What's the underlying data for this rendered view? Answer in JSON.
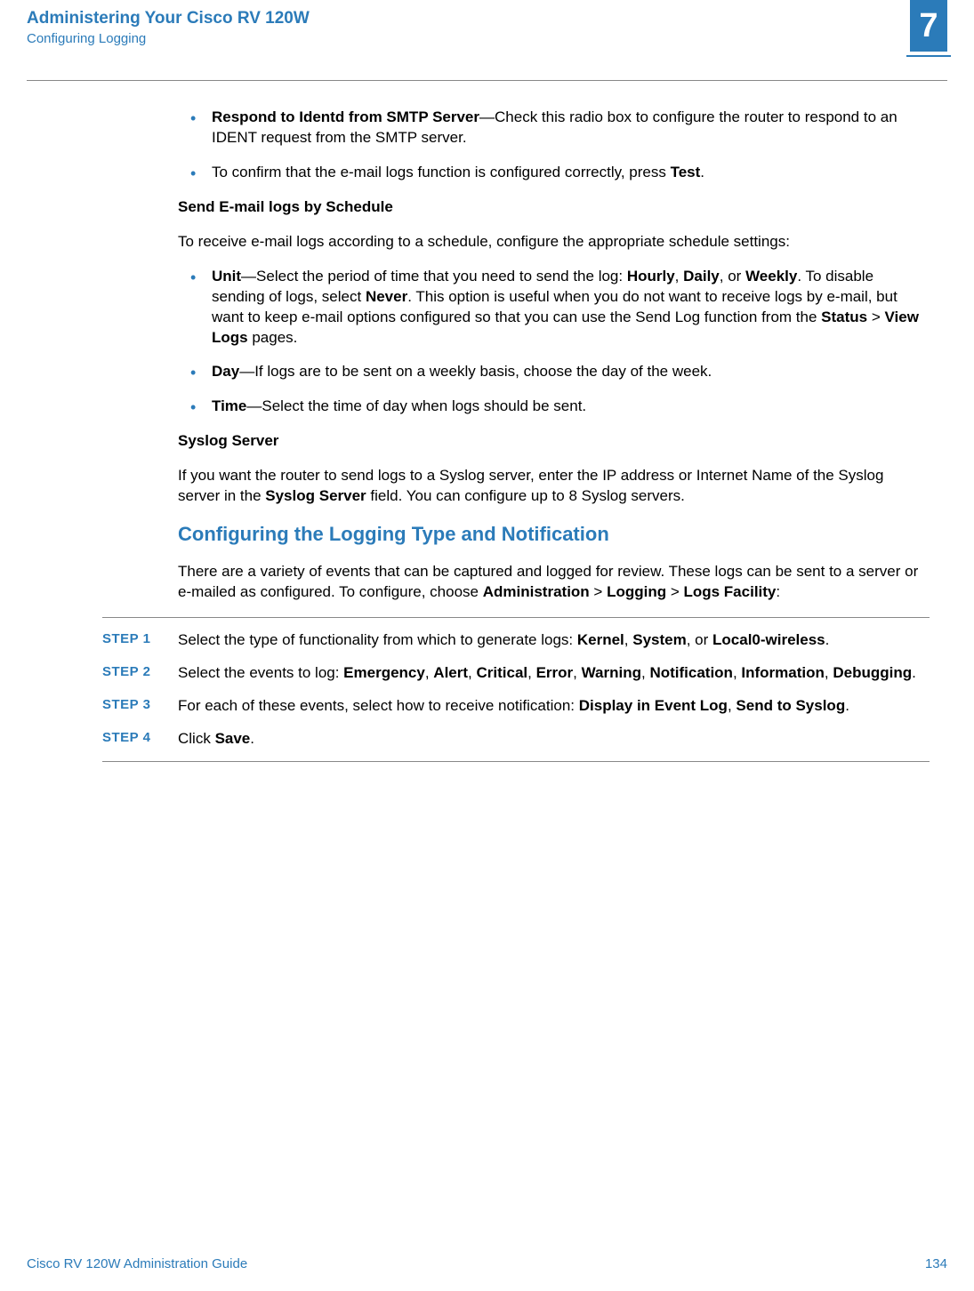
{
  "header": {
    "title": "Administering Your Cisco RV 120W",
    "subtitle": "Configuring Logging",
    "chapter_number": "7"
  },
  "top_bullets": [
    {
      "bold_lead": "Respond to Identd from SMTP Server",
      "rest": "—Check this radio box to configure the router to respond to an IDENT request from the SMTP server."
    },
    {
      "plain_pre": "To confirm that the e-mail logs function is configured correctly, press ",
      "bold_tail": "Test",
      "tail_punct": "."
    }
  ],
  "send_schedule": {
    "heading": "Send E-mail logs by Schedule",
    "intro": "To receive e-mail logs according to a schedule, configure the appropriate schedule settings:",
    "bullets": {
      "unit": {
        "lead": "Unit",
        "t1": "—Select the period of time that you need to send the log: ",
        "b1": "Hourly",
        "t2": ", ",
        "b2": "Daily",
        "t3": ", or ",
        "b3": "Weekly",
        "t4": ". To disable sending of logs, select ",
        "b4": "Never",
        "t5": ". This option is useful when you do not want to receive logs by e-mail, but want to keep e-mail options configured so that you can use the Send Log function from the ",
        "b5": "Status",
        "t6": " > ",
        "b6": "View Logs",
        "t7": " pages."
      },
      "day": {
        "lead": "Day",
        "rest": "—If logs are to be sent on a weekly basis, choose the day of the week."
      },
      "time": {
        "lead": "Time",
        "rest": "—Select the time of day when logs should be sent."
      }
    }
  },
  "syslog": {
    "heading": "Syslog Server",
    "p_pre": "If you want the router to send logs to a Syslog server, enter the IP address or Internet Name of the Syslog server in the ",
    "p_bold": "Syslog Server",
    "p_post": " field. You can configure up to 8 Syslog servers."
  },
  "section": {
    "heading": "Configuring the Logging Type and Notification",
    "intro_pre": "There are a variety of events that can be captured and logged for review. These logs can be sent to a server or e-mailed as configured. To configure, choose ",
    "b1": "Administration",
    "t1": " > ",
    "b2": "Logging",
    "t2": " > ",
    "b3": "Logs Facility",
    "t3": ":"
  },
  "steps": [
    {
      "label": "STEP  1",
      "pre": "Select the type of functionality from which to generate logs: ",
      "b1": "Kernel",
      "t1": ", ",
      "b2": "System",
      "t2": ", or ",
      "b3": "Local0-wireless",
      "t3": "."
    },
    {
      "label": "STEP  2",
      "pre": "Select the events to log: ",
      "b1": "Emergency",
      "t1": ", ",
      "b2": "Alert",
      "t2": ", ",
      "b3": "Critical",
      "t3": ", ",
      "b4": "Error",
      "t4": ", ",
      "b5": "Warning",
      "t5": ", ",
      "b6": "Notification",
      "t6": ", ",
      "b7": "Information",
      "t7": ", ",
      "b8": "Debugging",
      "t8": "."
    },
    {
      "label": "STEP  3",
      "pre": "For each of these events, select how to receive notification: ",
      "b1": "Display in Event Log",
      "t1": ", ",
      "b2": "Send to Syslog",
      "t2": "."
    },
    {
      "label": "STEP  4",
      "pre": "Click ",
      "b1": "Save",
      "t1": "."
    }
  ],
  "footer": {
    "left": "Cisco RV 120W Administration Guide",
    "right": "134"
  }
}
